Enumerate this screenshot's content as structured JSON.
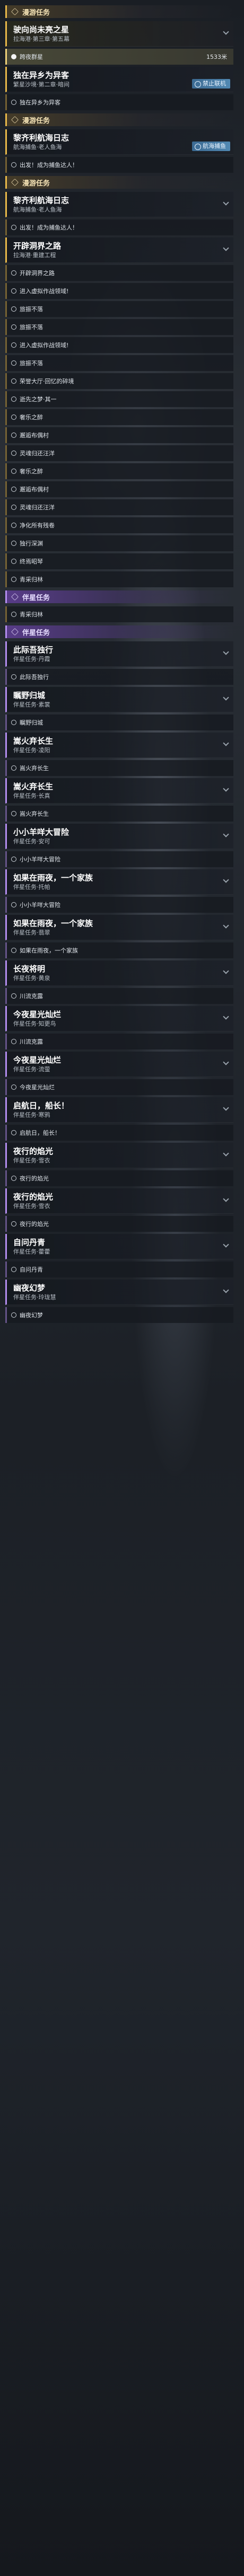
{
  "sections": [
    {
      "kind": "header",
      "style": "trailblaze",
      "label": "漫游任务"
    },
    {
      "kind": "card",
      "style": "trailblaze",
      "active": true,
      "title": "驶向尚未亮之星",
      "sub": "拉海港·第三章·第五幕"
    },
    {
      "kind": "objective",
      "style": "trailblaze",
      "tracked": true,
      "text": "跨夜群星",
      "distance": "1533米"
    },
    {
      "kind": "card",
      "style": "trailblaze",
      "title": "独在异乡为异客",
      "sub": "繁星沙境·第二章·暗间",
      "tag": "禁止联机"
    },
    {
      "kind": "objective",
      "style": "trailblaze",
      "text": "独在异乡为异客"
    },
    {
      "kind": "header",
      "style": "trailblaze",
      "label": "漫游任务"
    },
    {
      "kind": "card",
      "style": "trailblaze",
      "title": "黎齐利航海日志",
      "sub": "航海捕鱼·老人鱼海",
      "tag": "航海捕鱼"
    },
    {
      "kind": "objective",
      "style": "trailblaze",
      "text": "出发！成为捕鱼达人！"
    },
    {
      "kind": "header",
      "style": "trailblaze",
      "label": "漫游任务"
    },
    {
      "kind": "card",
      "style": "trailblaze",
      "title": "黎齐利航海日志",
      "sub": "航海捕鱼·老人鱼海"
    },
    {
      "kind": "objective",
      "style": "trailblaze",
      "text": "出发！成为捕鱼达人！"
    },
    {
      "kind": "card",
      "style": "trailblaze",
      "title": "开辟洞界之路",
      "sub": "拉海港·重建工程"
    },
    {
      "kind": "objective",
      "style": "trailblaze",
      "text": "开辟洞界之路"
    },
    {
      "kind": "objective",
      "style": "trailblaze",
      "text": "进入虚拟作战领域!"
    },
    {
      "kind": "objective",
      "style": "trailblaze",
      "text": "旅振不落"
    },
    {
      "kind": "objective",
      "style": "trailblaze",
      "text": "旅振不落"
    },
    {
      "kind": "objective",
      "style": "trailblaze",
      "text": "进入虚拟作战领域!"
    },
    {
      "kind": "objective",
      "style": "trailblaze",
      "text": "旅振不落"
    },
    {
      "kind": "objective",
      "style": "trailblaze",
      "text": "荣誉大厅·回忆的碎境"
    },
    {
      "kind": "objective",
      "style": "trailblaze",
      "text": "逝先之梦·其一"
    },
    {
      "kind": "objective",
      "style": "trailblaze",
      "text": "奢乐之醉"
    },
    {
      "kind": "objective",
      "style": "trailblaze",
      "text": "邂逅布偶村"
    },
    {
      "kind": "objective",
      "style": "trailblaze",
      "text": "灵魂归还汪洋"
    },
    {
      "kind": "objective",
      "style": "trailblaze",
      "text": "奢乐之醉"
    },
    {
      "kind": "objective",
      "style": "trailblaze",
      "text": "邂逅布偶村"
    },
    {
      "kind": "objective",
      "style": "trailblaze",
      "text": "灵魂归还汪洋"
    },
    {
      "kind": "objective",
      "style": "trailblaze",
      "text": "净化所有残卷"
    },
    {
      "kind": "objective",
      "style": "trailblaze",
      "text": "独行深渊"
    },
    {
      "kind": "objective",
      "style": "trailblaze",
      "text": "终焉昭琴"
    },
    {
      "kind": "objective",
      "style": "trailblaze",
      "text": "青采归林"
    },
    {
      "kind": "header",
      "style": "companion",
      "label": "伴星任务"
    },
    {
      "kind": "objective",
      "style": "trailblaze",
      "text": "青采归林"
    },
    {
      "kind": "header",
      "style": "companion",
      "label": "伴星任务"
    },
    {
      "kind": "card",
      "style": "companion",
      "title": "此际吾独行",
      "sub": "伴星任务·丹霞"
    },
    {
      "kind": "objective",
      "style": "companion",
      "text": "此际吾独行"
    },
    {
      "kind": "card",
      "style": "companion",
      "title": "瞩野归城",
      "sub": "伴星任务·素裳"
    },
    {
      "kind": "objective",
      "style": "companion",
      "text": "瞩野归城"
    },
    {
      "kind": "card",
      "style": "companion",
      "title": "嵩火弃长生",
      "sub": "伴星任务·凌阳"
    },
    {
      "kind": "objective",
      "style": "companion",
      "text": "嵩火弃长生"
    },
    {
      "kind": "card",
      "style": "companion",
      "title": "嵩火弃长生",
      "sub": "伴星任务·长真"
    },
    {
      "kind": "objective",
      "style": "companion",
      "text": "嵩火弃长生"
    },
    {
      "kind": "card",
      "style": "companion",
      "title": "小小羊咩大冒险",
      "sub": "伴星任务·安可"
    },
    {
      "kind": "objective",
      "style": "companion",
      "text": "小小羊咩大冒险"
    },
    {
      "kind": "card",
      "style": "companion",
      "title": "如果在雨夜，一个家族",
      "sub": "伴星任务·托帕"
    },
    {
      "kind": "objective",
      "style": "companion",
      "text": "小小羊咩大冒险"
    },
    {
      "kind": "card",
      "style": "companion",
      "title": "如果在雨夜，一个家族",
      "sub": "伴星任务·翡翠"
    },
    {
      "kind": "objective",
      "style": "companion",
      "text": "如果在雨夜，一个家族"
    },
    {
      "kind": "card",
      "style": "companion",
      "title": "长夜将明",
      "sub": "伴星任务·黄泉"
    },
    {
      "kind": "objective",
      "style": "companion",
      "text": "川流克露"
    },
    {
      "kind": "card",
      "style": "companion",
      "title": "今夜星光灿烂",
      "sub": "伴星任务·知更鸟"
    },
    {
      "kind": "objective",
      "style": "companion",
      "text": "川流克露"
    },
    {
      "kind": "card",
      "style": "companion",
      "title": "今夜星光灿烂",
      "sub": "伴星任务·流萤"
    },
    {
      "kind": "objective",
      "style": "companion",
      "text": "今夜星光灿烂"
    },
    {
      "kind": "card",
      "style": "companion",
      "title": "启航日，船长！",
      "sub": "伴星任务·寒鸦"
    },
    {
      "kind": "objective",
      "style": "companion",
      "text": "启航日，船长！"
    },
    {
      "kind": "card",
      "style": "companion",
      "title": "夜行的焰光",
      "sub": "伴星任务·雪衣"
    },
    {
      "kind": "objective",
      "style": "companion",
      "text": "夜行的焰光"
    },
    {
      "kind": "card",
      "style": "companion",
      "title": "夜行的焰光",
      "sub": "伴星任务·雪衣"
    },
    {
      "kind": "objective",
      "style": "companion",
      "text": "夜行的焰光"
    },
    {
      "kind": "card",
      "style": "companion",
      "title": "自问丹青",
      "sub": "伴星任务·藿藿"
    },
    {
      "kind": "objective",
      "style": "companion",
      "text": "自问丹青"
    },
    {
      "kind": "card",
      "style": "companion",
      "title": "幽夜幻梦",
      "sub": "伴星任务·玲珑慧"
    },
    {
      "kind": "objective",
      "style": "companion",
      "text": "幽夜幻梦"
    }
  ]
}
